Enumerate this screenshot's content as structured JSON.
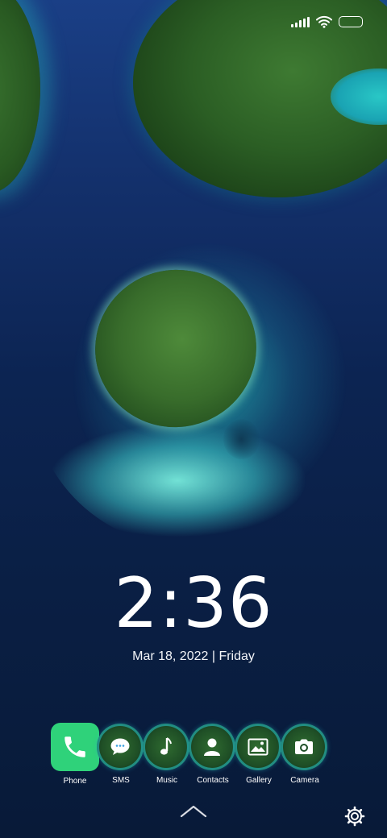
{
  "status_bar": {
    "icons": [
      "signal-icon",
      "wifi-icon",
      "battery-icon"
    ]
  },
  "lockscreen": {
    "time": "2:36",
    "date": "Mar 18, 2022 | Friday"
  },
  "dock": {
    "apps": [
      {
        "label": "Phone",
        "icon": "phone-icon"
      },
      {
        "label": "SMS",
        "icon": "sms-icon"
      },
      {
        "label": "Music",
        "icon": "music-note-icon"
      },
      {
        "label": "Contacts",
        "icon": "contacts-icon"
      },
      {
        "label": "Gallery",
        "icon": "gallery-icon"
      },
      {
        "label": "Camera",
        "icon": "camera-icon"
      }
    ]
  },
  "bottom": {
    "icons": [
      "chevron-up-icon",
      "gear-icon"
    ]
  },
  "colors": {
    "phone_app": "#2fd27a",
    "icon_ring": "#28c8d2",
    "text": "#ffffff"
  }
}
